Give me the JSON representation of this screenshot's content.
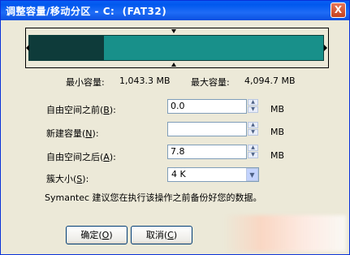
{
  "window": {
    "title": "调整容量/移动分区 - C:  (FAT32)",
    "close_label": "X"
  },
  "partition_bar": {
    "used_fraction": 0.255,
    "used_color": "#0e3b3a",
    "free_color": "#18908a"
  },
  "capacity": {
    "min_label": "最小容量:",
    "min_value": "1,043.3 MB",
    "max_label": "最大容量:",
    "max_value": "4,094.7 MB"
  },
  "fields": {
    "free_before": {
      "label_pre": "自由空间之前(",
      "mnemonic": "B",
      "label_post": "):",
      "value": "0.0",
      "unit": "MB"
    },
    "new_size": {
      "label_pre": "新建容量(",
      "mnemonic": "N",
      "label_post": "):",
      "value": "",
      "unit": "MB"
    },
    "free_after": {
      "label_pre": "自由空间之后(",
      "mnemonic": "A",
      "label_post": "):",
      "value": "7.8",
      "unit": "MB"
    },
    "cluster_size": {
      "label_pre": "簇大小(",
      "mnemonic": "S",
      "label_post": "):",
      "value": "4 K"
    }
  },
  "note": "Symantec 建议您在执行该操作之前备份好您的数据。",
  "buttons": {
    "ok": {
      "text": "确定(",
      "mnemonic": "O",
      "post": ")"
    },
    "cancel": {
      "text": "取消(",
      "mnemonic": "C",
      "post": ")"
    }
  },
  "icons": {
    "spin_up": "▲",
    "spin_down": "▼",
    "dropdown": "▼"
  }
}
